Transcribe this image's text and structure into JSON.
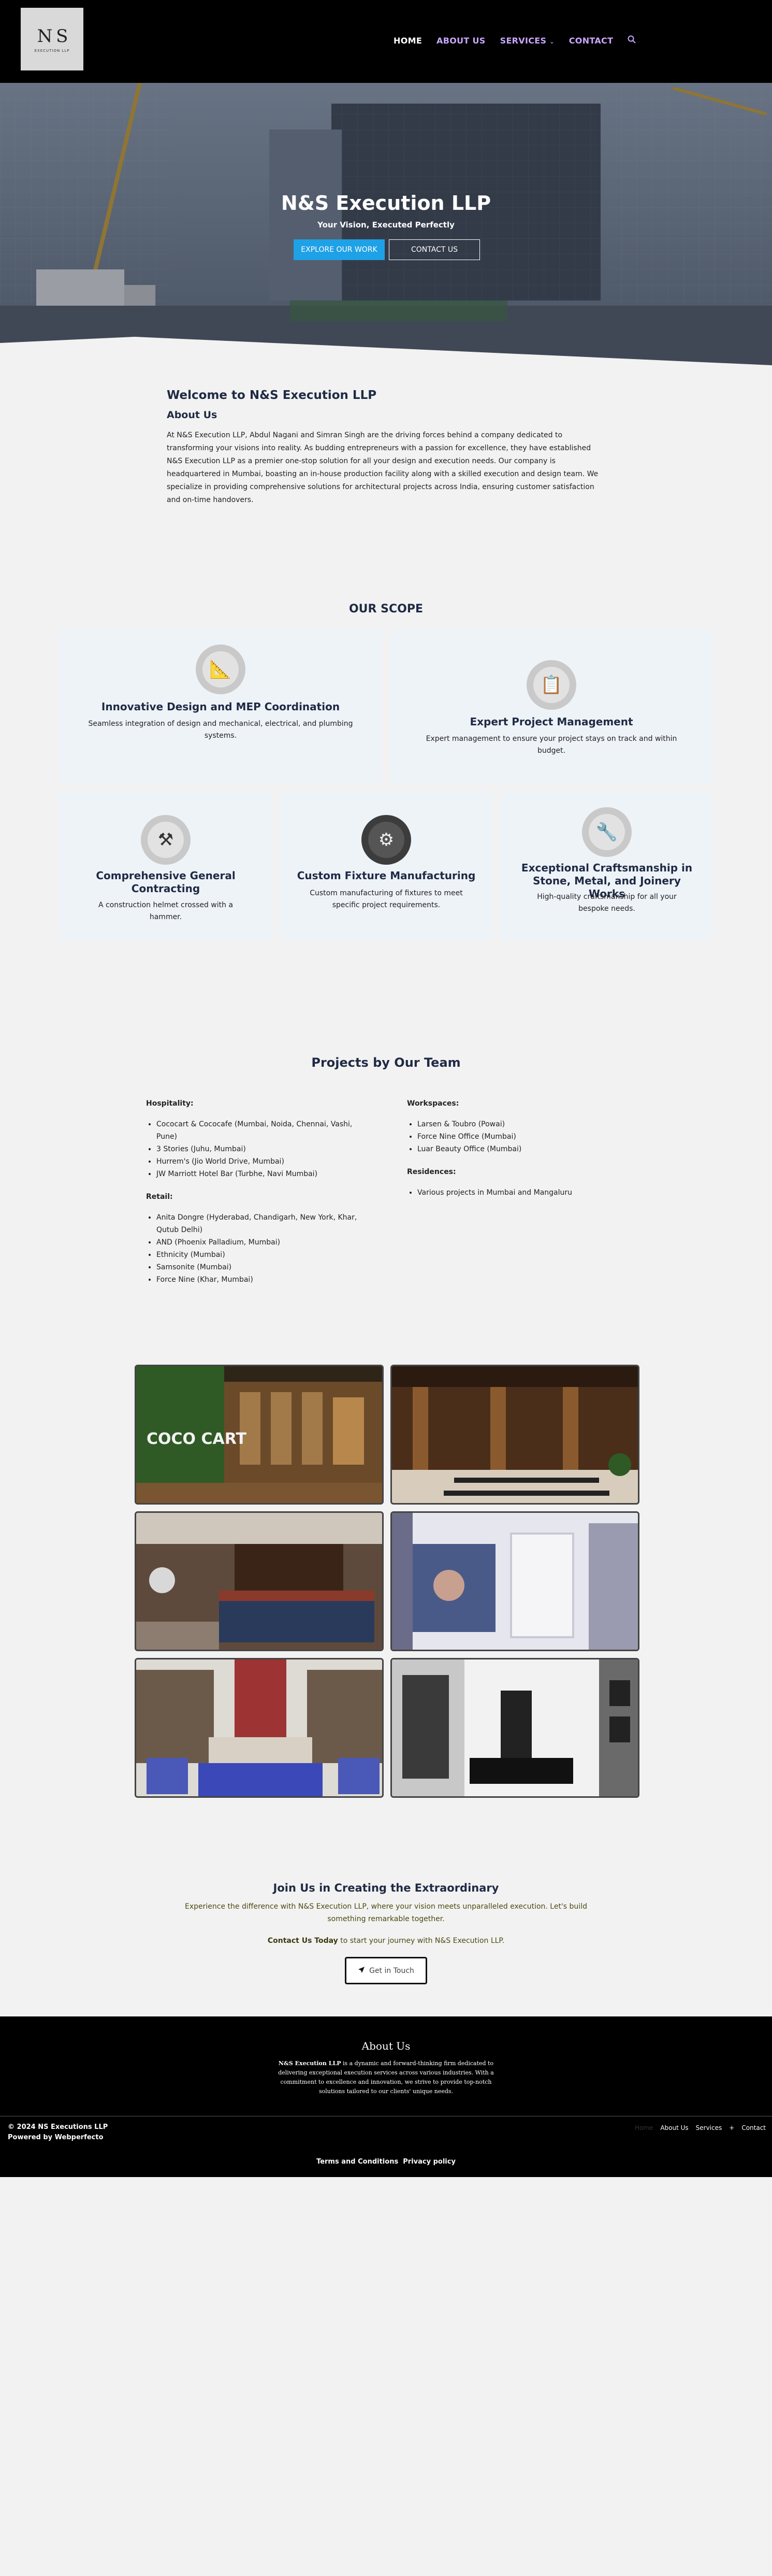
{
  "header": {
    "logo_mark": "N S",
    "logo_sub": "EXECUTION LLP",
    "nav": {
      "home": "HOME",
      "about": "ABOUT US",
      "services": "SERVICES",
      "contact": "CONTACT"
    }
  },
  "hero": {
    "title": "N&S Execution LLP",
    "subtitle": "Your Vision, Executed Perfectly",
    "explore_btn": "EXPLORE OUR WORK",
    "contact_btn": "CONTACT US"
  },
  "welcome": {
    "title": "Welcome to N&S Execution LLP",
    "about_heading": "About Us",
    "body": "At N&S Execution LLP, Abdul Nagani and Simran Singh are the driving forces behind a company dedicated to transforming your visions into reality. As budding entrepreneurs with a passion for excellence, they have established N&S Execution LLP as a premier one-stop solution for all your design and execution needs. Our company is headquartered in Mumbai, boasting an in-house production facility along with a skilled execution and design team. We specialize in providing comprehensive solutions for architectural projects across India, ensuring customer satisfaction and on-time handovers."
  },
  "scope": {
    "title": "OUR SCOPE",
    "cards": [
      {
        "title": "Innovative Design and MEP Coordination",
        "desc": "Seamless integration of design and mechanical, electrical, and plumbing systems.",
        "icon": "blueprint-icon"
      },
      {
        "title": "Expert Project Management",
        "desc": "Expert management to ensure your project stays on track and within budget.",
        "icon": "clipboard-icon"
      },
      {
        "title": "Comprehensive General Contracting",
        "desc": "A construction helmet crossed with a hammer.",
        "icon": "helmet-hammer-icon"
      },
      {
        "title": "Custom Fixture Manufacturing",
        "desc": "Custom manufacturing of fixtures to meet specific project requirements.",
        "icon": "gear-icon"
      },
      {
        "title": "Exceptional Craftsmanship in Stone, Metal, and Joinery Works",
        "desc": "High-quality craftsmanship for all your bespoke needs.",
        "icon": "saw-icon"
      }
    ]
  },
  "projects": {
    "title": "Projects by Our Team",
    "hospitality": {
      "heading": "Hospitality:",
      "items": [
        "Cococart & Cococafe (Mumbai, Noida, Chennai, Vashi, Pune)",
        "3 Stories (Juhu, Mumbai)",
        "Hurrem's (Jio World Drive, Mumbai)",
        "JW Marriott Hotel Bar (Turbhe, Navi Mumbai)"
      ]
    },
    "retail": {
      "heading": "Retail:",
      "items": [
        "Anita Dongre (Hyderabad, Chandigarh, New York, Khar, Qutub Delhi)",
        "AND (Phoenix Palladium, Mumbai)",
        "Ethnicity (Mumbai)",
        "Samsonite (Mumbai)",
        "Force Nine (Khar, Mumbai)"
      ]
    },
    "workspaces": {
      "heading": "Workspaces:",
      "items": [
        "Larsen & Toubro (Powai)",
        "Force Nine Office (Mumbai)",
        "Luar Beauty Office (Mumbai)"
      ]
    },
    "residences": {
      "heading": "Residences:",
      "items": [
        "Various projects in Mumbai and Mangaluru"
      ]
    }
  },
  "gallery": {
    "coco_sign": "COCO CART"
  },
  "join": {
    "title": "Join Us in Creating the Extraordinary",
    "body": "Experience the difference with N&S Execution LLP, where your vision meets unparalleled execution. Let's build something remarkable together.",
    "cta_bold": "Contact Us Today",
    "cta_rest": " to start your journey with N&S Execution LLP.",
    "button": "Get in Touch"
  },
  "footer": {
    "about_title": "About Us",
    "about_bold": "N&S Execution LLP",
    "about_body": " is a dynamic and forward-thinking firm dedicated to delivering exceptional execution services across various industries. With a commitment to excellence and innovation, we strive to provide top-notch solutions tailored to our clients' unique needs.",
    "copyright": "© 2024 NS Executions LLP",
    "powered": "Powered by Webperfecto",
    "nav": {
      "home": "Home",
      "about": "About Us",
      "services": "Services",
      "plus": "+",
      "contact": "Contact"
    },
    "legal": {
      "terms": "Terms and Conditions",
      "privacy": "Privacy policy"
    }
  },
  "colors": {
    "accent": "#1ea1e6",
    "nav_purple": "#c8a8ff",
    "heading": "#1f2a44",
    "card_bg": "#eef3f8"
  }
}
